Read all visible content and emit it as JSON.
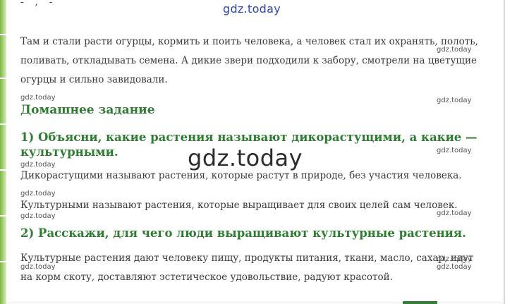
{
  "watermark_top": "gdz.today",
  "watermark_small": "gdz.today",
  "watermark_big": "gdz.today",
  "top_partial_text": "- , -",
  "paragraphs": {
    "intro": "Там и стали расти огурцы, кормить и поить человека, а человек стал их охранять, полоть, поливать, откладывать семена. А дикие звери подходили к забору, смотрели на цветущие огурцы и сильно завидовали.",
    "answer1a": "Дикорастущими называют растения, которые растут в природе, без участия человека.",
    "answer1b": "Культурными называют растения, которые выращивает для своих целей сам человек.",
    "answer2": "Культурные растения дают человеку пищу, продукты питания, ткани, масло, сахар, идут на корм скоту, доставляют эстетическое удовольствие, радуют красотой."
  },
  "headings": {
    "homework": "Домашнее задание",
    "question1": "1) Объясни, какие растения называют дикорастущими, а какие — культурными.",
    "question2": "2) Расскажи, для чего люди выращивают культурные растения."
  },
  "colors": {
    "heading_green": "#2e7d32",
    "watermark_blue": "#2a45b5",
    "body_text": "#3a3a3a"
  }
}
